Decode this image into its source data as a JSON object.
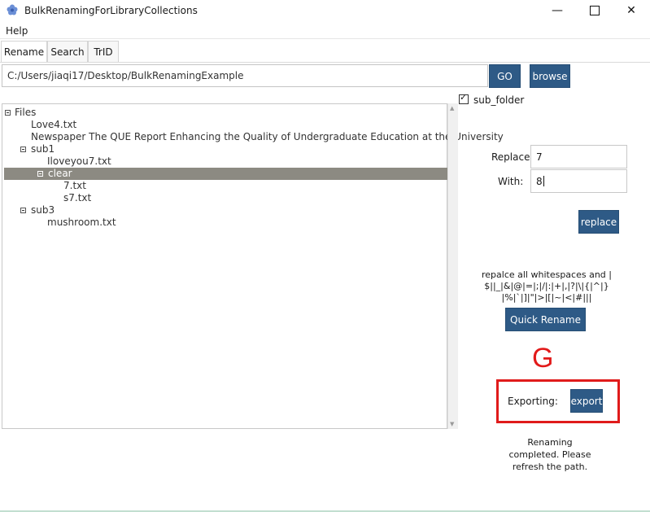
{
  "window": {
    "title": "BulkRenamingForLibraryCollections",
    "icons": {
      "app": "flower-icon",
      "minimize": "minimize-icon",
      "maximize": "maximize-icon",
      "close": "close-icon"
    }
  },
  "menu": {
    "help": "Help"
  },
  "tabs": [
    {
      "label": "Rename",
      "active": true
    },
    {
      "label": "Search",
      "active": false
    },
    {
      "label": "TrID",
      "active": false
    }
  ],
  "path": {
    "value": "C:/Users/jiaqi17/Desktop/BulkRenamingExample"
  },
  "buttons": {
    "go": "GO",
    "browse": "browse",
    "replace": "replace",
    "quick_rename": "Quick Rename",
    "export": "export"
  },
  "tree": {
    "root": "Files",
    "love4": "Love4.txt",
    "newspaper": "Newspaper The QUE Report  Enhancing the Quality of Undergraduate Education at the University",
    "sub1": "sub1",
    "iloveyou": "Iloveyou7.txt",
    "clear": "clear",
    "f7": "7.txt",
    "s7": "s7.txt",
    "sub3": "sub3",
    "mushroom": "mushroom.txt"
  },
  "options": {
    "sub_folder_label": "sub_folder",
    "sub_folder_checked": true
  },
  "replace_form": {
    "replace_label": "Replace:",
    "replace_value": "7",
    "with_label": "With:",
    "with_value": "8"
  },
  "whitespace_note": "repalce all whitespaces and |$||_|&|@|=|;|/|:|+|,|?|\\|{|^|}|%|`|]|\"|>|[|~|<|#|||",
  "annotation": {
    "letter": "G"
  },
  "export": {
    "label": "Exporting:"
  },
  "status": "Renaming completed. Please refresh the path.",
  "colors": {
    "button": "#2e5a86",
    "highlight": "#e01b1b",
    "selected_row": "#8c8a82"
  }
}
